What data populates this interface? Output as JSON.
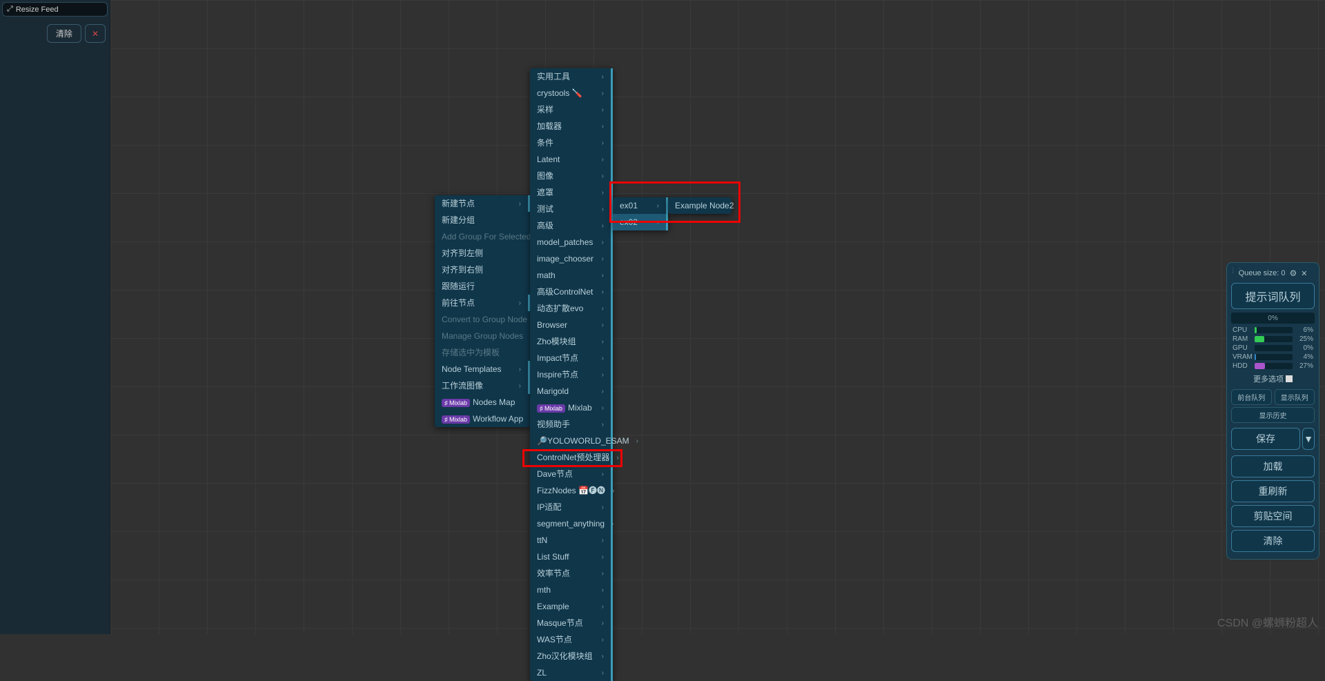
{
  "leftPanel": {
    "title": "Resize Feed",
    "clear": "清除",
    "close": "✕"
  },
  "menu1": [
    {
      "label": "新建节点",
      "sub": true
    },
    {
      "label": "新建分组"
    },
    {
      "label": "Add Group For Selected Nodes",
      "disabled": true
    },
    {
      "label": "对齐到左侧"
    },
    {
      "label": "对齐到右侧"
    },
    {
      "label": "跟随运行"
    },
    {
      "label": "前往节点",
      "sub": true
    },
    {
      "label": "Convert to Group Node",
      "disabled": true
    },
    {
      "label": "Manage Group Nodes",
      "disabled": true
    },
    {
      "label": "存储选中为模板",
      "disabled": true
    },
    {
      "label": "Node Templates",
      "sub": true
    },
    {
      "label": "工作流图像",
      "sub": true
    },
    {
      "label": "Nodes Map",
      "badge": "Mixlab"
    },
    {
      "label": "Workflow App",
      "badge": "Mixlab"
    }
  ],
  "menu2": [
    {
      "label": "实用工具",
      "sub": true
    },
    {
      "label": "crystools 🪛",
      "sub": true
    },
    {
      "label": "采样",
      "sub": true
    },
    {
      "label": "加载器",
      "sub": true
    },
    {
      "label": "条件",
      "sub": true
    },
    {
      "label": "Latent",
      "sub": true
    },
    {
      "label": "图像",
      "sub": true
    },
    {
      "label": "遮罩",
      "sub": true
    },
    {
      "label": "测试",
      "sub": true
    },
    {
      "label": "高级",
      "sub": true
    },
    {
      "label": "model_patches",
      "sub": true
    },
    {
      "label": "image_chooser",
      "sub": true
    },
    {
      "label": "math",
      "sub": true
    },
    {
      "label": "高级ControlNet",
      "sub": true
    },
    {
      "label": "动态扩散evo",
      "sub": true
    },
    {
      "label": "Browser",
      "sub": true
    },
    {
      "label": "Zho模块组",
      "sub": true
    },
    {
      "label": "Impact节点",
      "sub": true
    },
    {
      "label": "Inspire节点",
      "sub": true
    },
    {
      "label": "Marigold",
      "sub": true
    },
    {
      "label": "Mixlab",
      "badge": "Mixlab",
      "sub": true
    },
    {
      "label": "视频助手",
      "sub": true
    },
    {
      "label": "🔎YOLOWORLD_ESAM",
      "sub": true
    },
    {
      "label": "ControlNet预处理器",
      "sub": true
    },
    {
      "label": "Dave节点",
      "sub": true
    },
    {
      "label": "FizzNodes 📅🅕🅝",
      "sub": true
    },
    {
      "label": "IP适配",
      "sub": true
    },
    {
      "label": "segment_anything",
      "sub": true
    },
    {
      "label": "ttN",
      "sub": true
    },
    {
      "label": "List Stuff",
      "sub": true
    },
    {
      "label": "效率节点",
      "sub": true
    },
    {
      "label": "mth",
      "sub": true
    },
    {
      "label": "Example",
      "sub": true
    },
    {
      "label": "Masque节点",
      "sub": true
    },
    {
      "label": "WAS节点",
      "sub": true
    },
    {
      "label": "Zho汉化模块组",
      "sub": true
    },
    {
      "label": "ZL",
      "sub": true
    }
  ],
  "menu3": [
    {
      "label": "ex01",
      "sub": true
    },
    {
      "label": "ex02",
      "sub": true,
      "hover": true
    }
  ],
  "menu4": [
    {
      "label": "Example Node2"
    }
  ],
  "ctrl": {
    "queue": "Queue size: 0",
    "prompt": "提示词队列",
    "progress": "0%",
    "stats": [
      {
        "k": "CPU",
        "v": "6%",
        "w": 6,
        "c": "#33cc55"
      },
      {
        "k": "RAM",
        "v": "25%",
        "w": 25,
        "c": "#33cc55"
      },
      {
        "k": "GPU",
        "v": "0%",
        "w": 0,
        "c": "#33cc55"
      },
      {
        "k": "VRAM",
        "v": "4%",
        "w": 4,
        "c": "#3388cc"
      },
      {
        "k": "HDD",
        "v": "27%",
        "w": 27,
        "c": "#aa55cc"
      }
    ],
    "more": "更多选项",
    "miniBtns": [
      "前台队列",
      "显示队列"
    ],
    "history": "显示历史",
    "actions": [
      "保存",
      "加载",
      "重刷新",
      "剪贴空间",
      "清除"
    ],
    "dropdown": "▼"
  },
  "watermark": "CSDN @螺蛳粉超人"
}
